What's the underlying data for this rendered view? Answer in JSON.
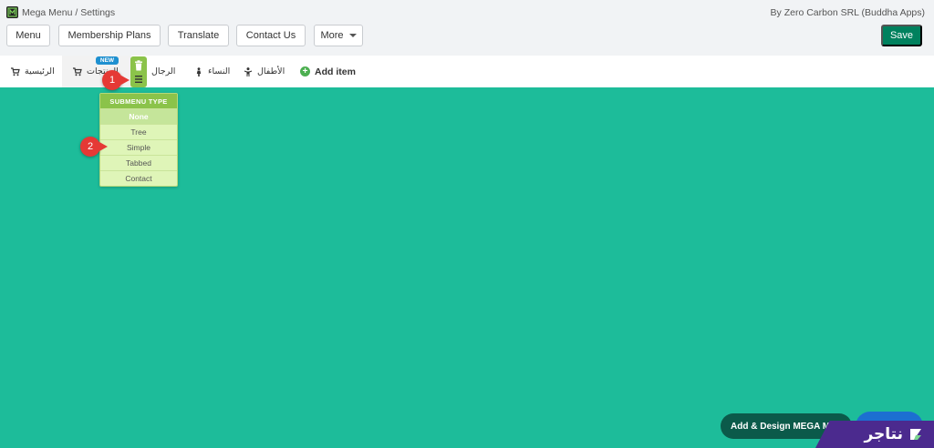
{
  "app": {
    "title": "Mega Menu / Settings",
    "vendor": "By Zero Carbon SRL (Buddha Apps)"
  },
  "toolbar": {
    "menu_label": "Menu",
    "membership_label": "Membership Plans",
    "translate_label": "Translate",
    "contact_label": "Contact Us",
    "more_label": "More",
    "save_label": "Save"
  },
  "menubar": {
    "items": [
      {
        "label": "الرئيسية",
        "icon": "cart-icon"
      },
      {
        "label": "المنتجات",
        "icon": "cart-icon",
        "badge": "NEW"
      },
      {
        "label": "الرجال",
        "icon": "man-icon"
      },
      {
        "label": "النساء",
        "icon": "woman-icon"
      },
      {
        "label": "الأطفال",
        "icon": "child-icon"
      }
    ],
    "add_item_label": "Add item"
  },
  "submenu": {
    "header": "SUBMENU TYPE",
    "options": [
      "None",
      "Tree",
      "Simple",
      "Tabbed",
      "Contact"
    ],
    "selected": "None"
  },
  "annotations": {
    "step1": "1",
    "step2": "2"
  },
  "footer": {
    "mega_button": "Add & Design MEGA MENU",
    "brand_text": "نتاجر"
  },
  "colors": {
    "canvas": "#1dbc9a",
    "save": "#00815e",
    "accent_green": "#8bc34a",
    "badge_blue": "#1e90d0",
    "step_red": "#e53935",
    "brand_purple": "#4b2a8e"
  }
}
